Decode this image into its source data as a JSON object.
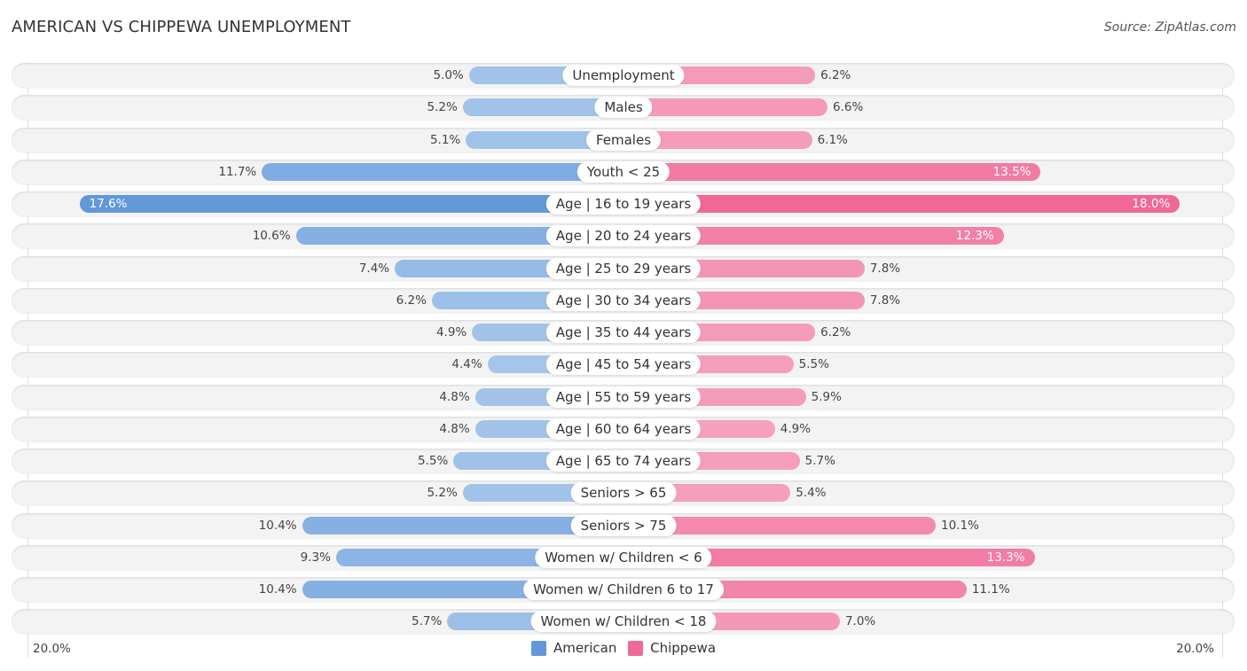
{
  "header": {
    "title": "AMERICAN VS CHIPPEWA UNEMPLOYMENT",
    "source": "Source: ZipAtlas.com"
  },
  "colors": {
    "american_light": "#a7c6ea",
    "american_strong": "#6098da",
    "chippewa_light": "#f5a5bf",
    "chippewa_strong": "#f06893"
  },
  "chart_data": {
    "type": "bar",
    "orientation": "horizontal-diverging",
    "title": "AMERICAN VS CHIPPEWA UNEMPLOYMENT",
    "source": "Source: ZipAtlas.com",
    "categories": [
      "Unemployment",
      "Males",
      "Females",
      "Youth < 25",
      "Age | 16 to 19 years",
      "Age | 20 to 24 years",
      "Age | 25 to 29 years",
      "Age | 30 to 34 years",
      "Age | 35 to 44 years",
      "Age | 45 to 54 years",
      "Age | 55 to 59 years",
      "Age | 60 to 64 years",
      "Age | 65 to 74 years",
      "Seniors > 65",
      "Seniors > 75",
      "Women w/ Children < 6",
      "Women w/ Children 6 to 17",
      "Women w/ Children < 18"
    ],
    "series": [
      {
        "name": "American",
        "side": "left",
        "values": [
          5.0,
          5.2,
          5.1,
          11.7,
          17.6,
          10.6,
          7.4,
          6.2,
          4.9,
          4.4,
          4.8,
          4.8,
          5.5,
          5.2,
          10.4,
          9.3,
          10.4,
          5.7
        ]
      },
      {
        "name": "Chippewa",
        "side": "right",
        "values": [
          6.2,
          6.6,
          6.1,
          13.5,
          18.0,
          12.3,
          7.8,
          7.8,
          6.2,
          5.5,
          5.9,
          4.9,
          5.7,
          5.4,
          10.1,
          13.3,
          11.1,
          7.0
        ]
      }
    ],
    "value_format": "{v}%",
    "xlim": [
      0,
      20.0
    ],
    "axis_labels": {
      "left": "20.0%",
      "right": "20.0%"
    },
    "legend": {
      "position": "bottom-center",
      "entries": [
        "American",
        "Chippewa"
      ]
    },
    "grid": false
  }
}
